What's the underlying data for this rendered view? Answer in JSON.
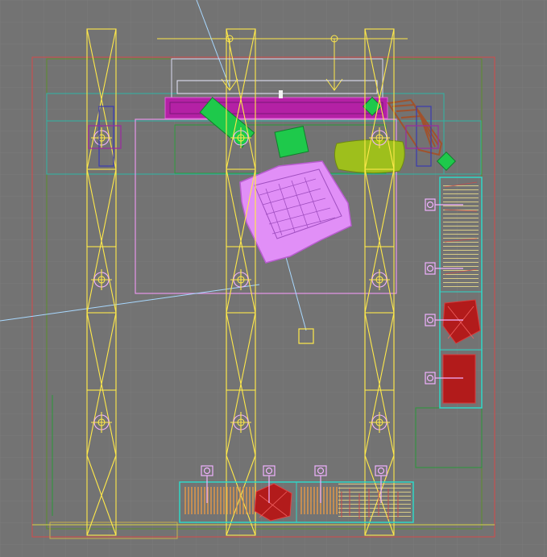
{
  "viewport": {
    "view_type": "Top",
    "render_mode": "wireframe",
    "grid": true
  },
  "colors": {
    "background": "#737373",
    "grid": "#7b7b7b",
    "room_boundary": "#d44a4a",
    "wall_outline": "#2fb5a4",
    "truss": "#ffe94a",
    "fixture": "#f1b1ff",
    "sofa_set": "#e18ff7",
    "tv_panel": "#b421a5",
    "green_chair": "#1ec94b",
    "lime_ottoman": "#9ebf1c",
    "hanger_rack": "#2fd7c7",
    "garment_red": "#b21b1b",
    "garment_orange": "#e79b48",
    "garment_yellow": "#efe08a",
    "camera_line": "#a8d8ff",
    "wood_chair": "#a0522d"
  },
  "objects": [
    "room-boundary",
    "truss-left",
    "truss-center",
    "truss-right",
    "top-light-bar",
    "sofa-set",
    "tv-panel",
    "green-chair-left",
    "green-chair-right",
    "lime-ottoman",
    "wood-lounge-chair",
    "right-clothing-rack",
    "bottom-clothing-rack",
    "target-marker",
    "camera-line"
  ]
}
